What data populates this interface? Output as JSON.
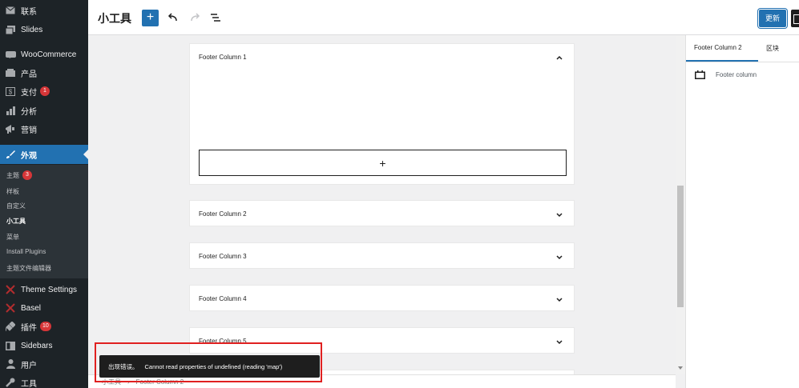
{
  "sidebar": {
    "items": [
      {
        "icon": "mail-icon",
        "label": "联系",
        "badge": null
      },
      {
        "icon": "slides-icon",
        "label": "Slides",
        "badge": null
      },
      {
        "icon": "woocommerce-icon",
        "label": "WooCommerce",
        "badge": null
      },
      {
        "icon": "products-icon",
        "label": "产品",
        "badge": null
      },
      {
        "icon": "payments-icon",
        "label": "支付",
        "badge": "1"
      },
      {
        "icon": "analytics-icon",
        "label": "分析",
        "badge": null
      },
      {
        "icon": "marketing-icon",
        "label": "营销",
        "badge": null
      },
      {
        "icon": "appearance-icon",
        "label": "外观",
        "badge": null
      },
      {
        "icon": "theme-settings-icon",
        "label": "Theme Settings",
        "badge": null
      },
      {
        "icon": "basel-icon",
        "label": "Basel",
        "badge": null
      },
      {
        "icon": "plugins-icon",
        "label": "插件",
        "badge": "10"
      },
      {
        "icon": "sidebars-icon",
        "label": "Sidebars",
        "badge": null
      },
      {
        "icon": "users-icon",
        "label": "用户",
        "badge": null
      },
      {
        "icon": "tools-icon",
        "label": "工具",
        "badge": null
      }
    ],
    "submenu": [
      {
        "label": "主题",
        "badge": "3"
      },
      {
        "label": "样板",
        "badge": null
      },
      {
        "label": "自定义",
        "badge": null
      },
      {
        "label": "小工具",
        "badge": null
      },
      {
        "label": "菜单",
        "badge": null
      },
      {
        "label": "Install Plugins",
        "badge": null
      },
      {
        "label": "主题文件编辑器",
        "badge": null
      }
    ]
  },
  "header": {
    "title": "小工具",
    "add_label": "+",
    "update_label": "更新"
  },
  "panels": [
    {
      "title": "Footer Column 1",
      "expanded": true,
      "appender": "+"
    },
    {
      "title": "Footer Column 2",
      "expanded": false
    },
    {
      "title": "Footer Column 3",
      "expanded": false
    },
    {
      "title": "Footer Column 4",
      "expanded": false
    },
    {
      "title": "Footer Column 5",
      "expanded": false
    }
  ],
  "breadcrumb": {
    "root": "小工具",
    "separator": "›",
    "current": "Footer Column 2"
  },
  "settings": {
    "tabs": [
      "Footer Column 2",
      "区块"
    ],
    "active_tab": "Footer Column 2",
    "block_card": {
      "icon": "calendar-icon",
      "label": "Footer column"
    }
  },
  "snackbar": {
    "label": "出现错误。",
    "message": "Cannot read properties of undefined (reading 'map')"
  },
  "colors": {
    "accent": "#2271b1",
    "sidebar_bg": "#1d2327",
    "error_badge": "#d63638",
    "annotation": "#e02020"
  }
}
